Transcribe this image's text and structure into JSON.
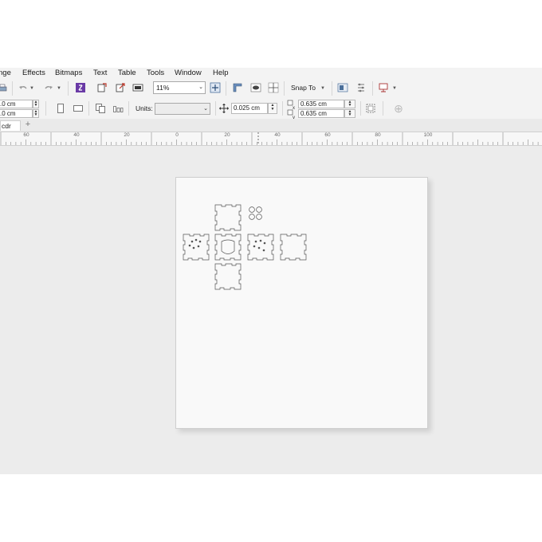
{
  "menu": {
    "items": [
      "nge",
      "Effects",
      "Bitmaps",
      "Text",
      "Table",
      "Tools",
      "Window",
      "Help"
    ]
  },
  "toolbar": {
    "zoom_value": "11%",
    "snap_to_label": "Snap To"
  },
  "property_bar": {
    "width_value": ".0 cm",
    "height_value": ".0 cm",
    "units_label": "Units:",
    "units_value": "",
    "nudge_value": "0.025 cm",
    "duplicate_x_value": "0.635 cm",
    "duplicate_y_value": "0.635 cm"
  },
  "tabs": {
    "document_tab": "cdr"
  },
  "ruler": {
    "labels": [
      "60",
      "40",
      "20",
      "0",
      "20",
      "40",
      "60",
      "80",
      "100"
    ]
  }
}
